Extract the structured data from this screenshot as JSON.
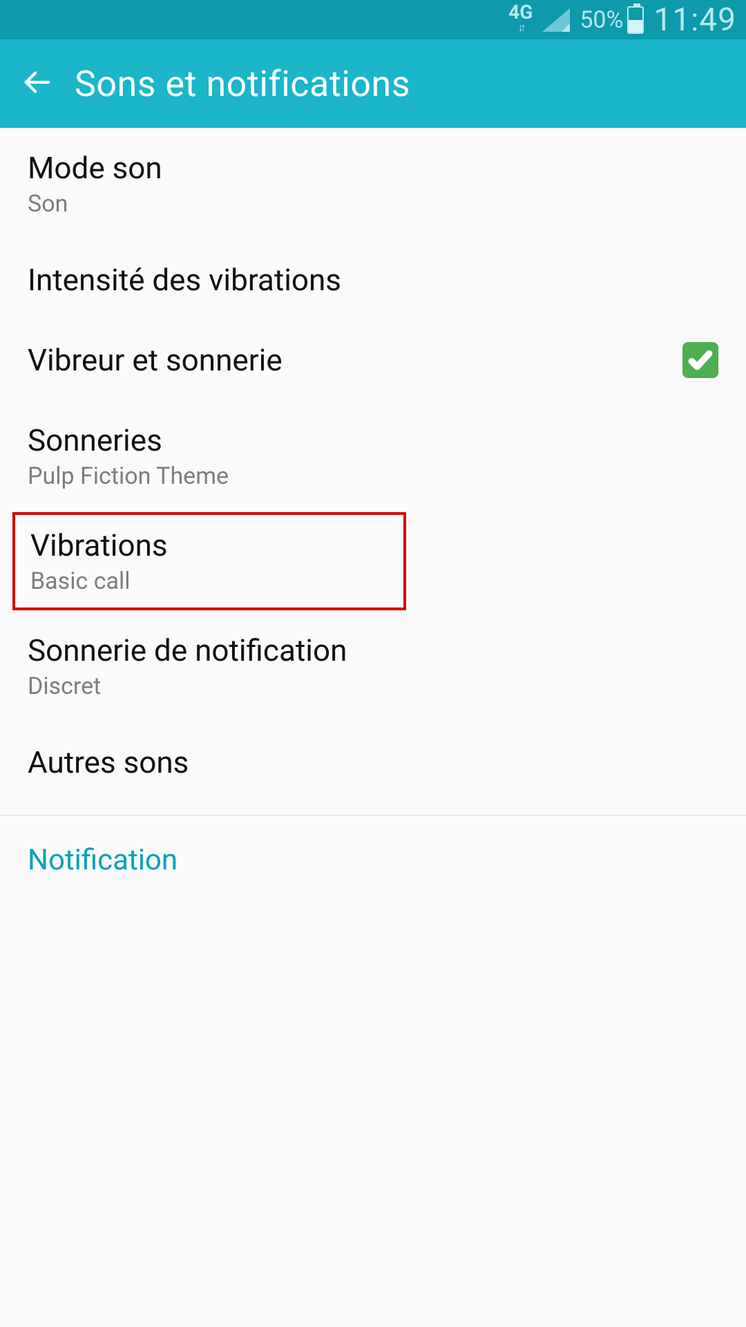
{
  "status": {
    "network": "4G",
    "battery_pct": "50%",
    "time": "11:49"
  },
  "header": {
    "title": "Sons et notifications"
  },
  "items": {
    "mode_son": {
      "title": "Mode son",
      "sub": "Son"
    },
    "intensite": {
      "title": "Intensité des vibrations"
    },
    "vibreur_sonnerie": {
      "title": "Vibreur et sonnerie",
      "checked": true
    },
    "sonneries": {
      "title": "Sonneries",
      "sub": "Pulp Fiction Theme"
    },
    "vibrations": {
      "title": "Vibrations",
      "sub": "Basic call"
    },
    "sonnerie_notif": {
      "title": "Sonnerie de notification",
      "sub": "Discret"
    },
    "autres_sons": {
      "title": "Autres sons"
    }
  },
  "section": {
    "notification": "Notification"
  }
}
